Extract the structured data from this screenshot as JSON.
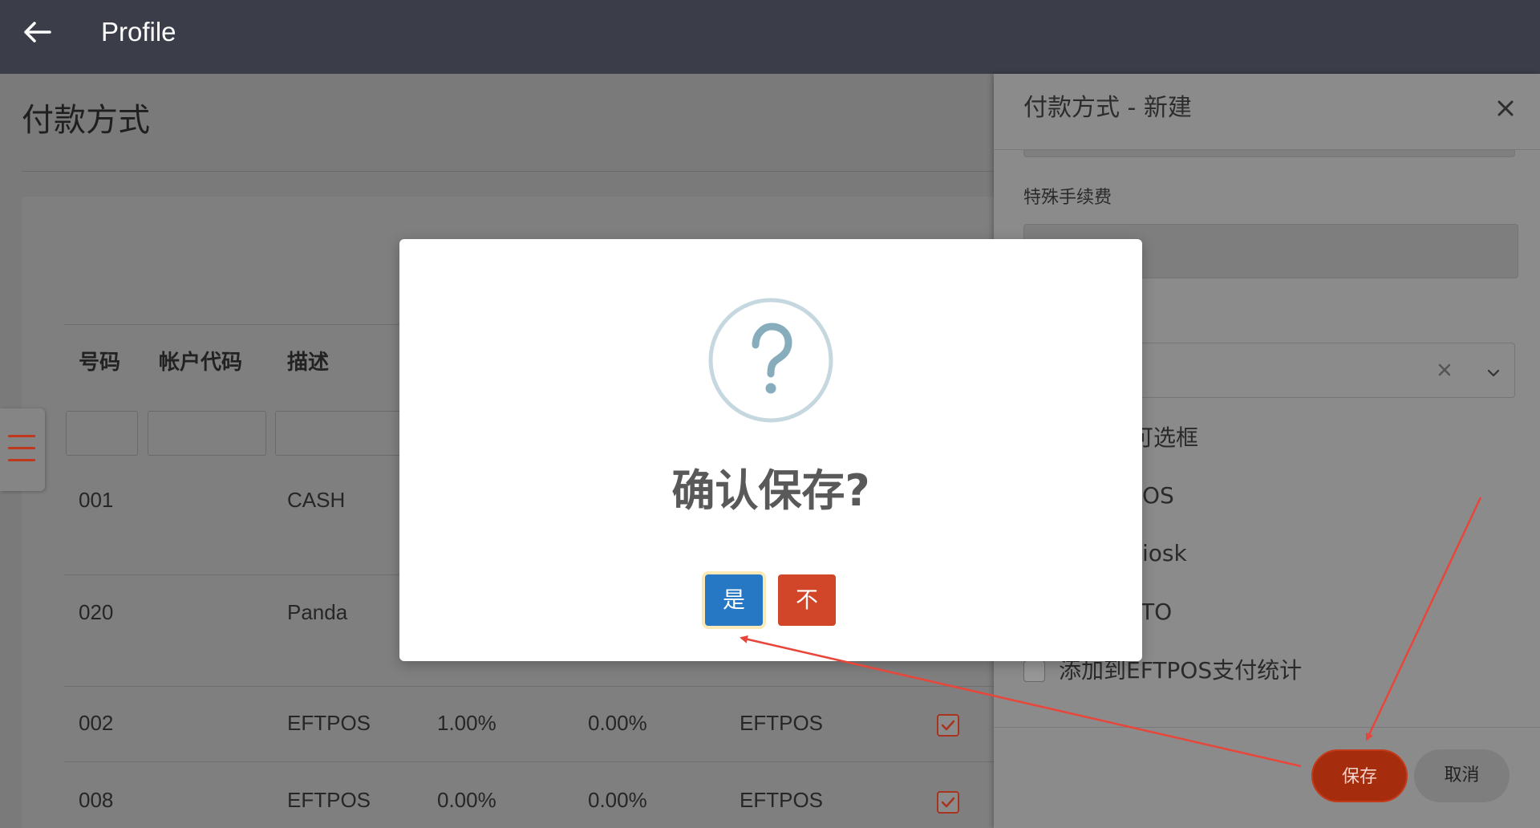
{
  "app": {
    "title": "Profile"
  },
  "page": {
    "title": "付款方式"
  },
  "table": {
    "columns": [
      "号码",
      "帐户代码",
      "描述"
    ],
    "rows": [
      {
        "code": "001",
        "description": "CASH"
      },
      {
        "code": "020",
        "description": "Panda"
      },
      {
        "code": "002",
        "description": "EFTPOS",
        "fee_1": "1.00%",
        "fee_2": "0.00%",
        "type": "EFTPOS",
        "checked": true
      },
      {
        "code": "008",
        "description": "EFTPOS",
        "fee_1": "0.00%",
        "fee_2": "0.00%",
        "type": "EFTPOS",
        "checked": true
      }
    ]
  },
  "panel": {
    "title": "付款方式 - 新建",
    "special_fee_label": "特殊手续费",
    "options": [
      "可选框",
      "OS",
      "iosk",
      "TO"
    ],
    "eftpos_stats_label": "添加到EFTPOS支付统计",
    "eftpos_stats_checked": false,
    "save_label": "保存",
    "cancel_label": "取消"
  },
  "dialog": {
    "title": "确认保存?",
    "yes_label": "是",
    "no_label": "不"
  },
  "colors": {
    "top_bar": "#3b3e48",
    "confirm_yes": "#2778c4",
    "confirm_no": "#d14529",
    "save": "#a62c0e",
    "annotation": "#e8463a"
  },
  "icons": {
    "back": "arrow-left-icon",
    "menu": "hamburger-menu-icon",
    "close": "close-icon",
    "dialog": "question-circle-icon",
    "clear": "clear-x-icon",
    "dropdown": "chevron-down-icon"
  }
}
